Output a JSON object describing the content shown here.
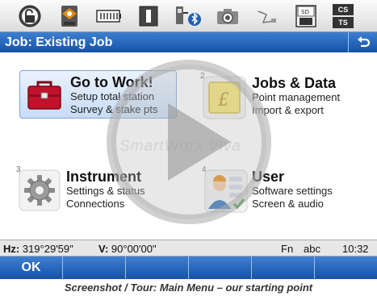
{
  "toolbar": {
    "icons": [
      "unlock-icon",
      "robot-icon",
      "battery-icon",
      "info-icon",
      "measure-bluetooth-icon",
      "camera-icon",
      "survey-mode-icon",
      "sd-card-icon"
    ],
    "cs_label": "CS",
    "ts_label": "TS"
  },
  "titlebar": {
    "title": "Job: Existing Job",
    "back_icon": "back-arrow-icon"
  },
  "menu": [
    {
      "number": "",
      "title": "Go to Work!",
      "lines": [
        "Setup total station",
        "Survey & stake pts"
      ],
      "icon": "toolbox-icon",
      "selected": true
    },
    {
      "number": "2",
      "title": "Jobs & Data",
      "lines": [
        "Point management",
        "Import & export"
      ],
      "icon": "jobs-data-icon",
      "selected": false
    },
    {
      "number": "3",
      "title": "Instrument",
      "lines": [
        "Settings & status",
        "Connections"
      ],
      "icon": "gear-icon",
      "selected": false
    },
    {
      "number": "4",
      "title": "User",
      "lines": [
        "Software settings",
        "Screen & audio"
      ],
      "icon": "user-icon",
      "selected": false
    }
  ],
  "watermark": "SmartWorx Viva",
  "status": {
    "hz_label": "Hz:",
    "hz_value": "319°29'59\"",
    "v_label": "V:",
    "v_value": "90°00'00\"",
    "fn": "Fn",
    "input_mode": "abc",
    "time": "10:32"
  },
  "softkeys": [
    "OK",
    "",
    "",
    "",
    "",
    ""
  ],
  "caption": "Screenshot / Tour:  Main Menu – our starting point",
  "colors": {
    "title_blue": "#1552a7",
    "accent_orange": "#e38b10",
    "selected_tile": "#c7dcf6"
  }
}
